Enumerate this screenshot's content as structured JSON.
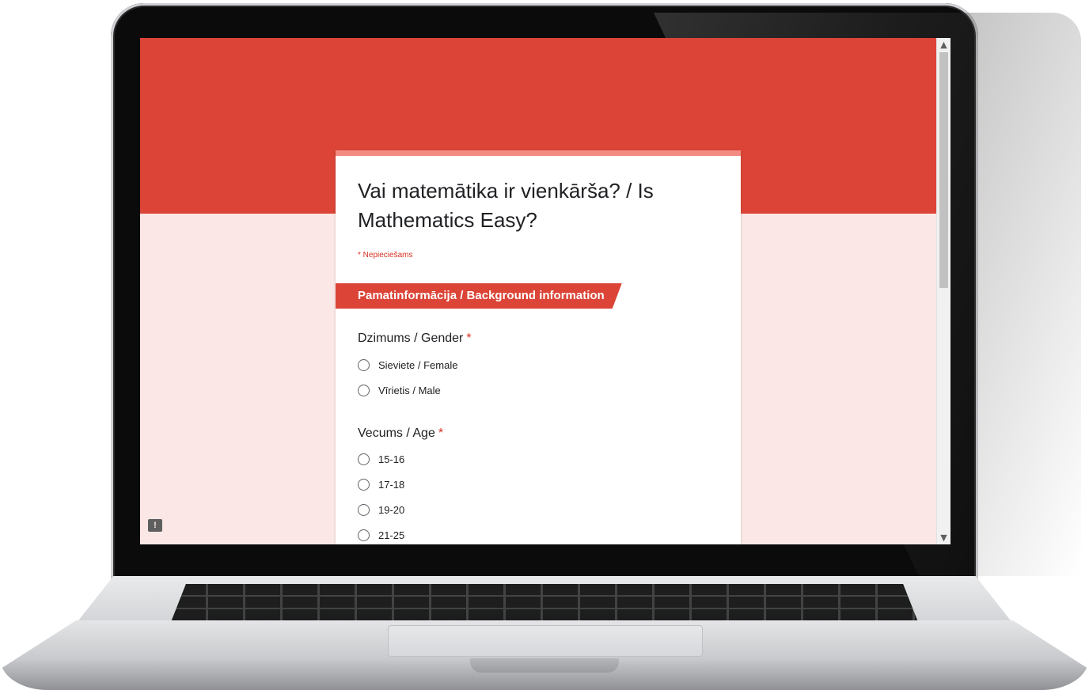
{
  "form": {
    "title": "Vai matemātika ir vienkārša? / Is Mathematics Easy?",
    "required_note": "* Nepieciešams",
    "section_title": "Pamatinformācija / Background information",
    "questions": [
      {
        "label": "Dzimums / Gender",
        "required_mark": "*",
        "options": [
          "Sieviete / Female",
          "Vīrietis / Male"
        ]
      },
      {
        "label": "Vecums / Age",
        "required_mark": "*",
        "options": [
          "15-16",
          "17-18",
          "19-20",
          "21-25"
        ]
      }
    ]
  },
  "scrollbar": {
    "up_icon": "▲",
    "down_icon": "▼"
  },
  "feedback": {
    "icon": "!"
  },
  "colors": {
    "accent": "#db4437",
    "background": "#fbe8e6",
    "card_top_border": "#f28b82",
    "required": "#d93025"
  }
}
